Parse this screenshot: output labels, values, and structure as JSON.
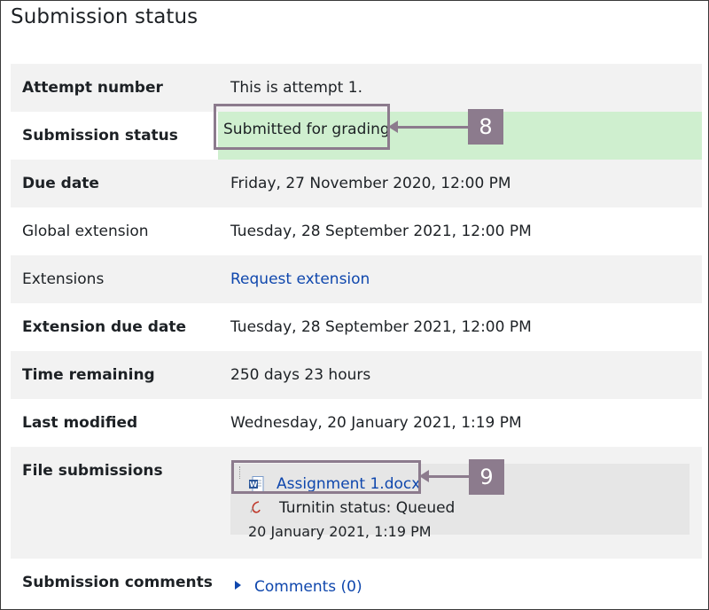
{
  "page_title": "Submission status",
  "rows": [
    {
      "label": "Attempt number",
      "value": "This is attempt 1."
    },
    {
      "label": "Submission status",
      "value": "Submitted for grading"
    },
    {
      "label": "Due date",
      "value": "Friday, 27 November 2020, 12:00 PM"
    },
    {
      "label": "Global extension",
      "value": "Tuesday, 28 September 2021, 12:00 PM"
    },
    {
      "label": "Extensions",
      "value": "Request extension"
    },
    {
      "label": "Extension due date",
      "value": "Tuesday, 28 September 2021, 12:00 PM"
    },
    {
      "label": "Time remaining",
      "value": "250 days 23 hours"
    },
    {
      "label": "Last modified",
      "value": "Wednesday, 20 January 2021, 1:19 PM"
    },
    {
      "label": "File submissions"
    },
    {
      "label": "Submission comments"
    }
  ],
  "file": {
    "name": "Assignment 1.docx",
    "turnitin_status": "Turnitin status: Queued",
    "date": "20 January 2021, 1:19 PM",
    "icon": "word-doc-icon"
  },
  "comments_link": "Comments (0)",
  "callouts": [
    "8",
    "9"
  ],
  "colors": {
    "status_green": "#cfefcf",
    "callout": "#8c7b8d",
    "link": "#0f47ad",
    "stripe": "#f2f2f2"
  }
}
